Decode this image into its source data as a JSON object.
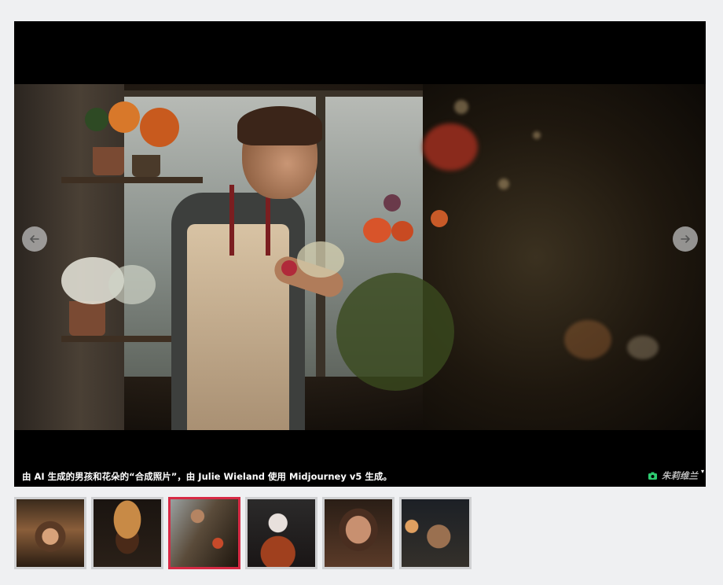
{
  "viewer": {
    "caption": "由 AI 生成的男孩和花朵的“合成照片”，由 Julie Wieland 使用 Midjourney v5 生成。",
    "credit": "朱莉维兰",
    "prev_icon": "arrow-left-icon",
    "next_icon": "arrow-right-icon",
    "credit_icon": "camera-icon",
    "credit_icon_color": "#2ecc71",
    "caret": "▾"
  },
  "thumbnails": {
    "active_index": 2,
    "active_border_color": "#d72a45",
    "items": [
      {
        "subject": "woman-in-diner-thumbnail"
      },
      {
        "subject": "burger-thumbnail"
      },
      {
        "subject": "boy-with-flowers-thumbnail"
      },
      {
        "subject": "clown-thumbnail"
      },
      {
        "subject": "woman-portrait-thumbnail"
      },
      {
        "subject": "warrior-thumbnail"
      }
    ]
  }
}
